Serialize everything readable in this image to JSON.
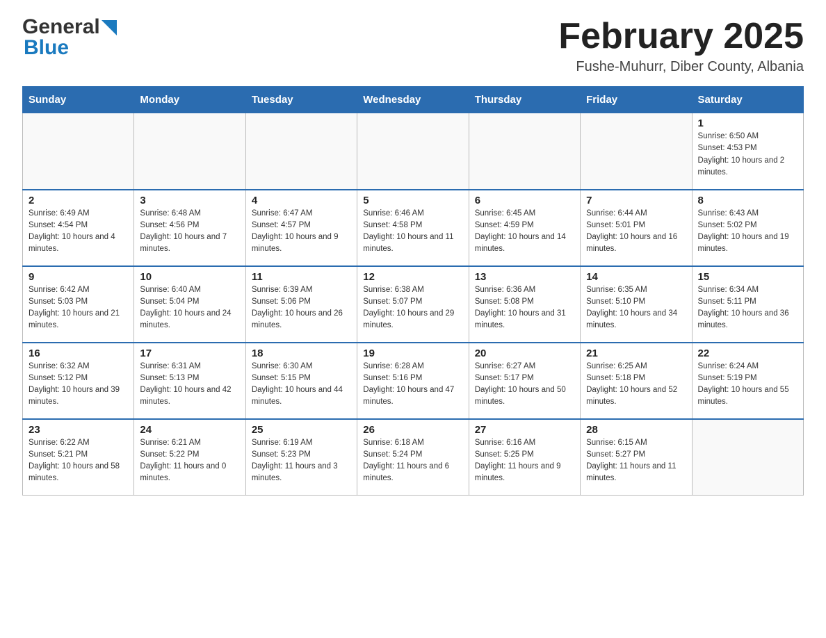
{
  "header": {
    "logo_general": "General",
    "logo_blue": "Blue",
    "title": "February 2025",
    "subtitle": "Fushe-Muhurr, Diber County, Albania"
  },
  "days_of_week": [
    "Sunday",
    "Monday",
    "Tuesday",
    "Wednesday",
    "Thursday",
    "Friday",
    "Saturday"
  ],
  "weeks": [
    [
      {
        "day": "",
        "info": ""
      },
      {
        "day": "",
        "info": ""
      },
      {
        "day": "",
        "info": ""
      },
      {
        "day": "",
        "info": ""
      },
      {
        "day": "",
        "info": ""
      },
      {
        "day": "",
        "info": ""
      },
      {
        "day": "1",
        "info": "Sunrise: 6:50 AM\nSunset: 4:53 PM\nDaylight: 10 hours and 2 minutes."
      }
    ],
    [
      {
        "day": "2",
        "info": "Sunrise: 6:49 AM\nSunset: 4:54 PM\nDaylight: 10 hours and 4 minutes."
      },
      {
        "day": "3",
        "info": "Sunrise: 6:48 AM\nSunset: 4:56 PM\nDaylight: 10 hours and 7 minutes."
      },
      {
        "day": "4",
        "info": "Sunrise: 6:47 AM\nSunset: 4:57 PM\nDaylight: 10 hours and 9 minutes."
      },
      {
        "day": "5",
        "info": "Sunrise: 6:46 AM\nSunset: 4:58 PM\nDaylight: 10 hours and 11 minutes."
      },
      {
        "day": "6",
        "info": "Sunrise: 6:45 AM\nSunset: 4:59 PM\nDaylight: 10 hours and 14 minutes."
      },
      {
        "day": "7",
        "info": "Sunrise: 6:44 AM\nSunset: 5:01 PM\nDaylight: 10 hours and 16 minutes."
      },
      {
        "day": "8",
        "info": "Sunrise: 6:43 AM\nSunset: 5:02 PM\nDaylight: 10 hours and 19 minutes."
      }
    ],
    [
      {
        "day": "9",
        "info": "Sunrise: 6:42 AM\nSunset: 5:03 PM\nDaylight: 10 hours and 21 minutes."
      },
      {
        "day": "10",
        "info": "Sunrise: 6:40 AM\nSunset: 5:04 PM\nDaylight: 10 hours and 24 minutes."
      },
      {
        "day": "11",
        "info": "Sunrise: 6:39 AM\nSunset: 5:06 PM\nDaylight: 10 hours and 26 minutes."
      },
      {
        "day": "12",
        "info": "Sunrise: 6:38 AM\nSunset: 5:07 PM\nDaylight: 10 hours and 29 minutes."
      },
      {
        "day": "13",
        "info": "Sunrise: 6:36 AM\nSunset: 5:08 PM\nDaylight: 10 hours and 31 minutes."
      },
      {
        "day": "14",
        "info": "Sunrise: 6:35 AM\nSunset: 5:10 PM\nDaylight: 10 hours and 34 minutes."
      },
      {
        "day": "15",
        "info": "Sunrise: 6:34 AM\nSunset: 5:11 PM\nDaylight: 10 hours and 36 minutes."
      }
    ],
    [
      {
        "day": "16",
        "info": "Sunrise: 6:32 AM\nSunset: 5:12 PM\nDaylight: 10 hours and 39 minutes."
      },
      {
        "day": "17",
        "info": "Sunrise: 6:31 AM\nSunset: 5:13 PM\nDaylight: 10 hours and 42 minutes."
      },
      {
        "day": "18",
        "info": "Sunrise: 6:30 AM\nSunset: 5:15 PM\nDaylight: 10 hours and 44 minutes."
      },
      {
        "day": "19",
        "info": "Sunrise: 6:28 AM\nSunset: 5:16 PM\nDaylight: 10 hours and 47 minutes."
      },
      {
        "day": "20",
        "info": "Sunrise: 6:27 AM\nSunset: 5:17 PM\nDaylight: 10 hours and 50 minutes."
      },
      {
        "day": "21",
        "info": "Sunrise: 6:25 AM\nSunset: 5:18 PM\nDaylight: 10 hours and 52 minutes."
      },
      {
        "day": "22",
        "info": "Sunrise: 6:24 AM\nSunset: 5:19 PM\nDaylight: 10 hours and 55 minutes."
      }
    ],
    [
      {
        "day": "23",
        "info": "Sunrise: 6:22 AM\nSunset: 5:21 PM\nDaylight: 10 hours and 58 minutes."
      },
      {
        "day": "24",
        "info": "Sunrise: 6:21 AM\nSunset: 5:22 PM\nDaylight: 11 hours and 0 minutes."
      },
      {
        "day": "25",
        "info": "Sunrise: 6:19 AM\nSunset: 5:23 PM\nDaylight: 11 hours and 3 minutes."
      },
      {
        "day": "26",
        "info": "Sunrise: 6:18 AM\nSunset: 5:24 PM\nDaylight: 11 hours and 6 minutes."
      },
      {
        "day": "27",
        "info": "Sunrise: 6:16 AM\nSunset: 5:25 PM\nDaylight: 11 hours and 9 minutes."
      },
      {
        "day": "28",
        "info": "Sunrise: 6:15 AM\nSunset: 5:27 PM\nDaylight: 11 hours and 11 minutes."
      },
      {
        "day": "",
        "info": ""
      }
    ]
  ]
}
